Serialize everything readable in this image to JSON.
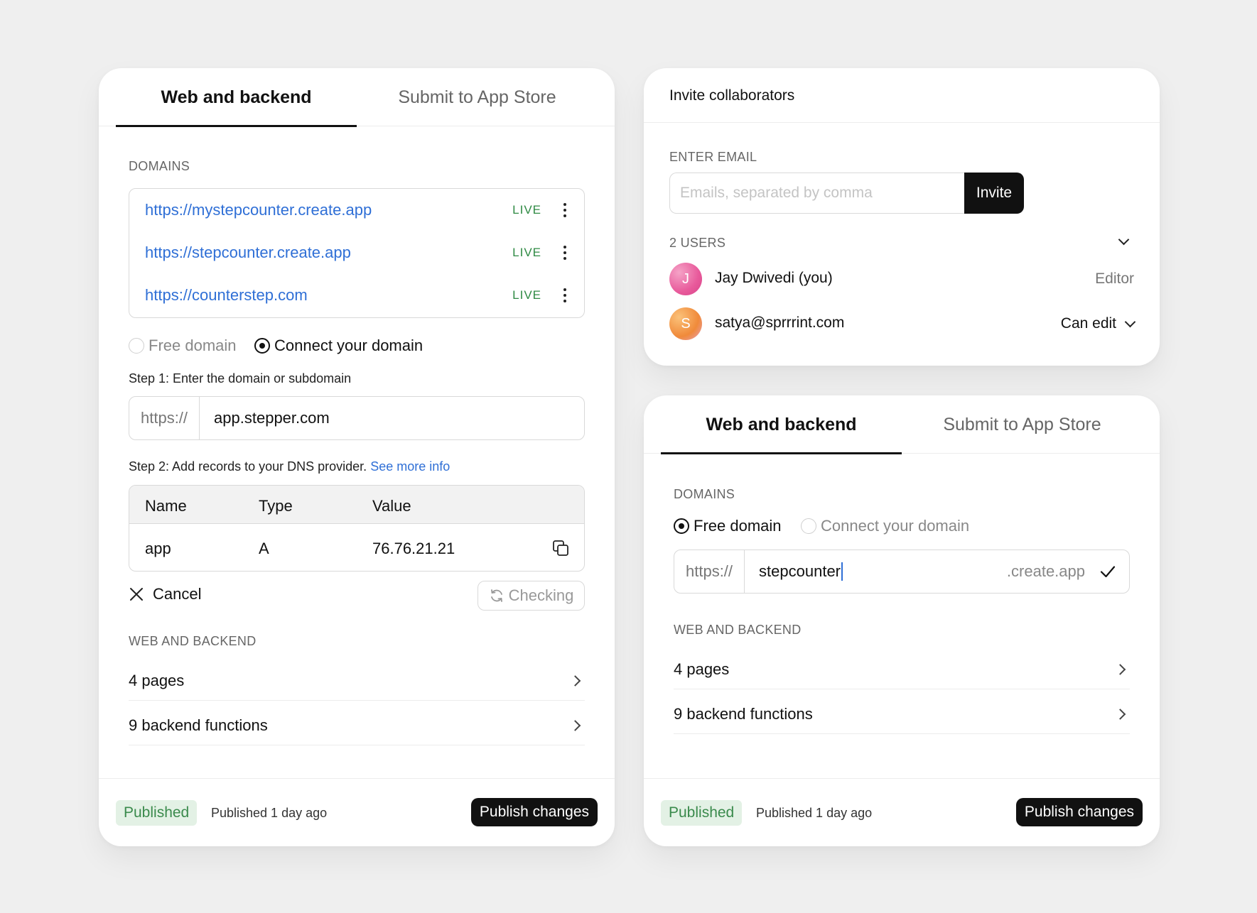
{
  "left_card": {
    "tabs": [
      "Web and backend",
      "Submit to App Store"
    ],
    "domains_label": "DOMAINS",
    "domains": [
      {
        "url": "https://mystepcounter.create.app",
        "status": "LIVE"
      },
      {
        "url": "https://stepcounter.create.app",
        "status": "LIVE"
      },
      {
        "url": "https://counterstep.com",
        "status": "LIVE"
      }
    ],
    "radio_free": "Free domain",
    "radio_connect": "Connect your domain",
    "step1": "Step 1: Enter the domain or subdomain",
    "url_prefix": "https://",
    "url_value": "app.stepper.com",
    "step2": "Step 2: Add records to your DNS provider.",
    "see_more": "See more info",
    "dns": {
      "headers": [
        "Name",
        "Type",
        "Value"
      ],
      "row": [
        "app",
        "A",
        "76.76.21.21"
      ]
    },
    "cancel": "Cancel",
    "checking": "Checking",
    "web_label": "WEB AND BACKEND",
    "nav": [
      "4 pages",
      "9 backend functions"
    ],
    "badge": "Published",
    "published_time": "Published 1 day ago",
    "publish_button": "Publish changes"
  },
  "invite_card": {
    "title": "Invite collaborators",
    "email_label": "ENTER EMAIL",
    "email_placeholder": "Emails, separated by comma",
    "invite_button": "Invite",
    "users_label": "2 USERS",
    "users": [
      {
        "initial": "J",
        "name": "Jay Dwivedi  (you)",
        "role": "Editor"
      },
      {
        "initial": "S",
        "name": "satya@sprrrint.com",
        "role": "Can edit"
      }
    ]
  },
  "right_card": {
    "tabs": [
      "Web and backend",
      "Submit to App Store"
    ],
    "domains_label": "DOMAINS",
    "radio_free": "Free domain",
    "radio_connect": "Connect your domain",
    "url_prefix": "https://",
    "url_value": "stepcounter",
    "url_suffix": ".create.app",
    "web_label": "WEB AND BACKEND",
    "nav": [
      "4 pages",
      "9 backend functions"
    ],
    "badge": "Published",
    "published_time": "Published 1 day ago",
    "publish_button": "Publish changes"
  },
  "colors": {
    "link": "#2f6fd6",
    "live": "#2f8a44",
    "badge_bg": "#e3f1e5",
    "badge_text": "#3a8a4c",
    "button_dark": "#111111"
  }
}
